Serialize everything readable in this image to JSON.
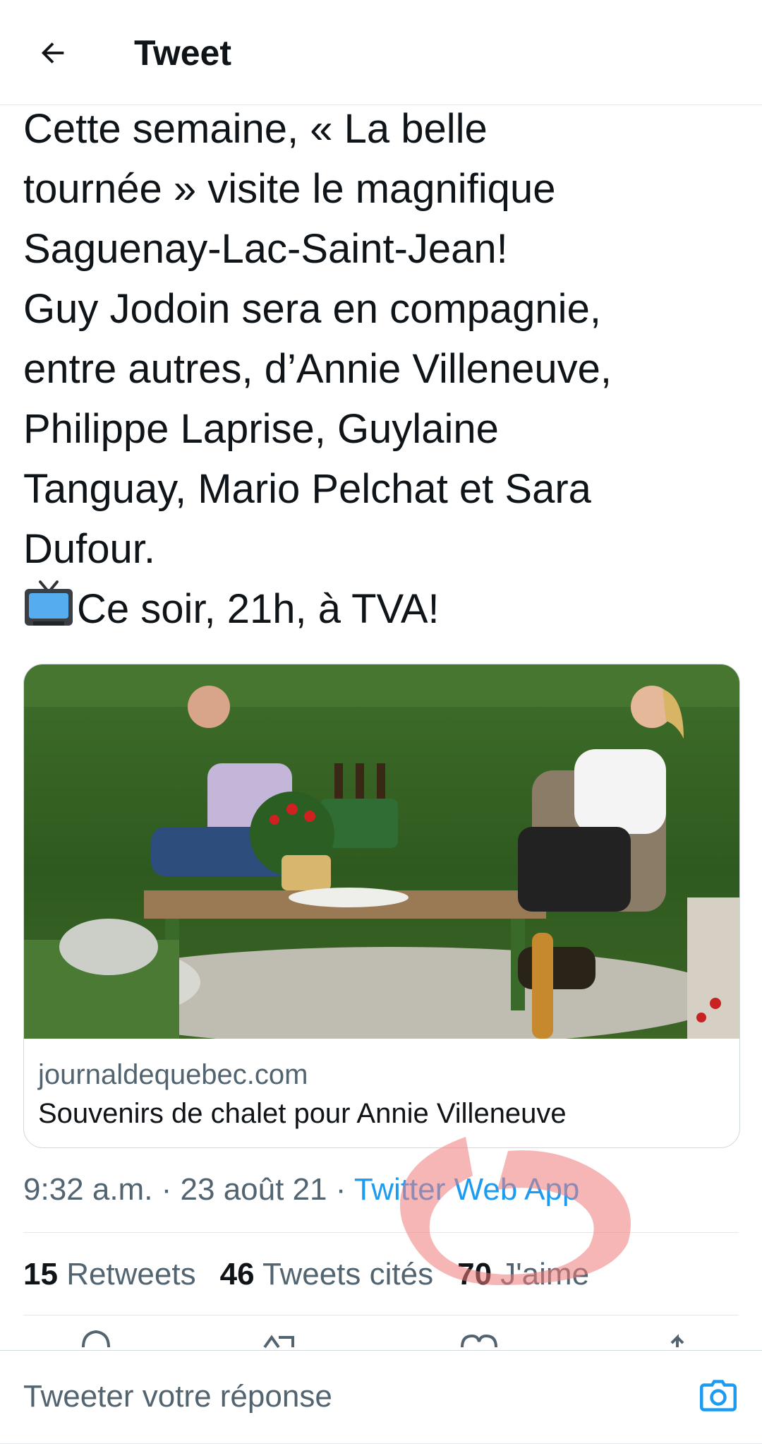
{
  "header": {
    "title": "Tweet",
    "back_icon": "arrow-left-icon"
  },
  "tweet": {
    "text": "Cette semaine, « La belle\ntournée » visite le magnifique\nSaguenay-Lac-Saint-Jean!\nGuy Jodoin sera en compagnie,\nentre autres, d’Annie Villeneuve,\nPhilippe Laprise, Guylaine\nTanguay, Mario Pelchat et Sara\nDufour.",
    "last_line_emoji": "television-icon",
    "last_line": "Ce soir, 21h, à TVA!"
  },
  "card": {
    "domain": "journaldequebec.com",
    "title": "Souvenirs de chalet pour Annie Villeneuve"
  },
  "meta": {
    "time": "9:32 a.m.",
    "sep1": " · ",
    "date": "23 août 21",
    "sep2": " · ",
    "source": "Twitter Web App"
  },
  "stats": {
    "retweets_count": "15",
    "retweets_label": "Retweets",
    "quotes_count": "46",
    "quotes_label": "Tweets cités",
    "likes_count": "70",
    "likes_label": "J'aime"
  },
  "reply": {
    "placeholder": "Tweeter votre réponse",
    "camera_icon": "camera-icon"
  },
  "colors": {
    "accent": "#1d9bf0",
    "text": "#0f1419",
    "secondary": "#536471",
    "border": "#cfd9de",
    "annotation": "#f07a7a"
  }
}
